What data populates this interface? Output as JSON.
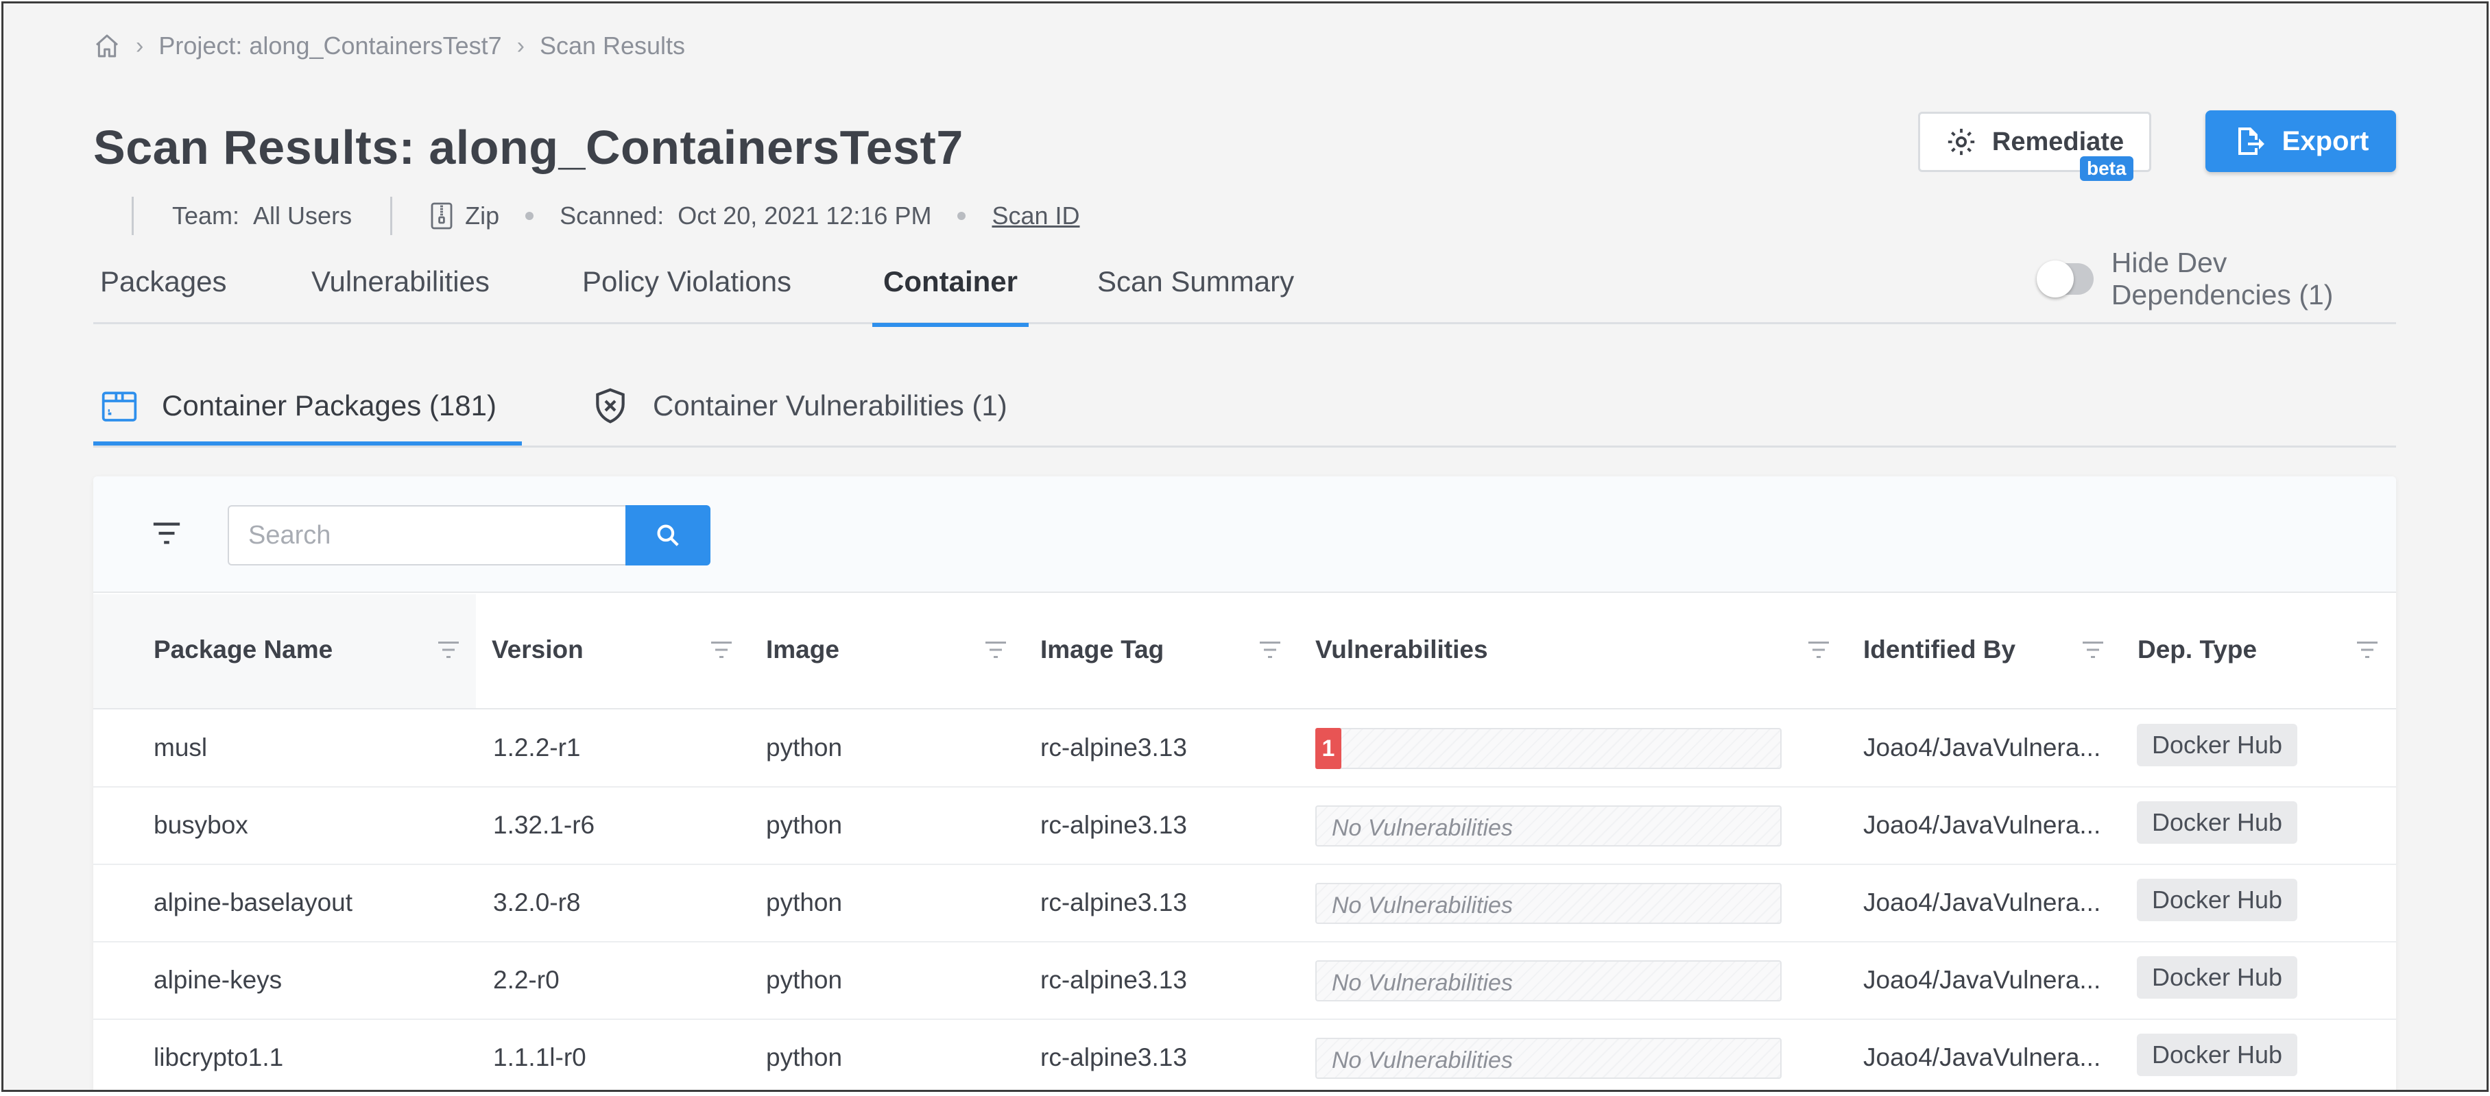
{
  "breadcrumb": {
    "items": [
      "Project: along_ContainersTest7",
      "Scan Results"
    ],
    "separator": "›"
  },
  "title": "Scan Results: along_ContainersTest7",
  "meta": {
    "team_label": "Team:",
    "team_value": "All Users",
    "source": "Zip",
    "scanned_label": "Scanned:",
    "scanned_value": "Oct 20, 2021 12:16 PM",
    "scan_id_link": "Scan ID"
  },
  "actions": {
    "remediate_label": "Remediate",
    "remediate_badge": "beta",
    "export_label": "Export"
  },
  "tabs": [
    {
      "label": "Packages",
      "active": false
    },
    {
      "label": "Vulnerabilities",
      "active": false
    },
    {
      "label": "Policy Violations",
      "active": false
    },
    {
      "label": "Container",
      "active": true
    },
    {
      "label": "Scan Summary",
      "active": false
    }
  ],
  "toggle": {
    "label": "Hide Dev Dependencies (1)",
    "on": false
  },
  "subtabs": [
    {
      "label": "Container Packages (181)",
      "icon": "package-icon",
      "active": true
    },
    {
      "label": "Container Vulnerabilities (1)",
      "icon": "shield-x-icon",
      "active": false
    }
  ],
  "search": {
    "placeholder": "Search",
    "value": ""
  },
  "table": {
    "columns": [
      "Package Name",
      "Version",
      "Image",
      "Image Tag",
      "Vulnerabilities",
      "Identified By",
      "Dep. Type"
    ],
    "no_vuln_text": "No Vulnerabilities",
    "rows": [
      {
        "name": "musl",
        "version": "1.2.2-r1",
        "image": "python",
        "tag": "rc-alpine3.13",
        "vulns": "1",
        "identified_by": "Joao4/JavaVulnera...",
        "dep_type": "Docker Hub"
      },
      {
        "name": "busybox",
        "version": "1.32.1-r6",
        "image": "python",
        "tag": "rc-alpine3.13",
        "vulns": "",
        "identified_by": "Joao4/JavaVulnera...",
        "dep_type": "Docker Hub"
      },
      {
        "name": "alpine-baselayout",
        "version": "3.2.0-r8",
        "image": "python",
        "tag": "rc-alpine3.13",
        "vulns": "",
        "identified_by": "Joao4/JavaVulnera...",
        "dep_type": "Docker Hub"
      },
      {
        "name": "alpine-keys",
        "version": "2.2-r0",
        "image": "python",
        "tag": "rc-alpine3.13",
        "vulns": "",
        "identified_by": "Joao4/JavaVulnera...",
        "dep_type": "Docker Hub"
      },
      {
        "name": "libcrypto1.1",
        "version": "1.1.1l-r0",
        "image": "python",
        "tag": "rc-alpine3.13",
        "vulns": "",
        "identified_by": "Joao4/JavaVulnera...",
        "dep_type": "Docker Hub"
      }
    ]
  },
  "colors": {
    "accent": "#2e8fec",
    "critical": "#e85454",
    "background": "#f4f4f4"
  }
}
